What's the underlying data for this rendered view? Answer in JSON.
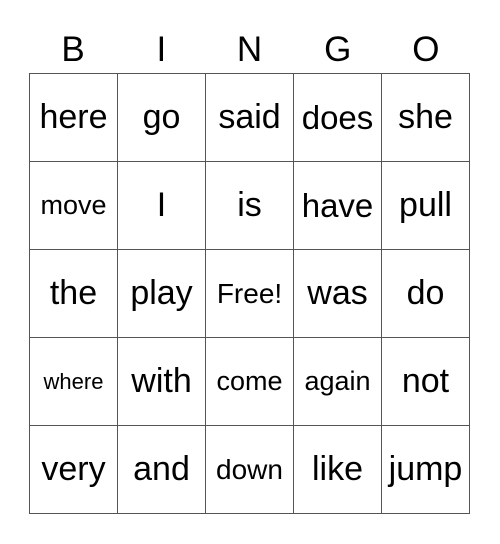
{
  "header": [
    "B",
    "I",
    "N",
    "G",
    "O"
  ],
  "rows": [
    [
      "here",
      "go",
      "said",
      "does",
      "she"
    ],
    [
      "move",
      "I",
      "is",
      "have",
      "pull"
    ],
    [
      "the",
      "play",
      "Free!",
      "was",
      "do"
    ],
    [
      "where",
      "with",
      "come",
      "again",
      "not"
    ],
    [
      "very",
      "and",
      "down",
      "like",
      "jump"
    ]
  ]
}
